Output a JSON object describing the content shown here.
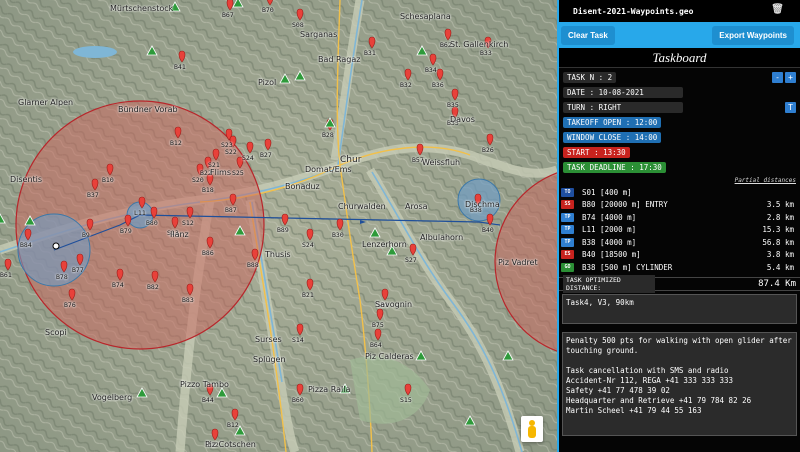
{
  "file": {
    "name": "Disent-2021-Waypoints.geo",
    "delete_icon": "trash-icon"
  },
  "buttons": {
    "clear": "Clear Task",
    "export": "Export Waypoints"
  },
  "taskboard": {
    "title": "Taskboard",
    "task_no": "TASK N : 2",
    "date": "DATE : 10-08-2021",
    "turn": "TURN : RIGHT",
    "takeoff_open": "TAKEOFF OPEN : 12:00",
    "window_close": "WINDOW CLOSE : 14:00",
    "start": "START : 13:30",
    "deadline": "TASK DEADLINE : 17:30",
    "minus": "-",
    "plus": "+",
    "t_button": "T",
    "partial_label": "Partial distances",
    "turnpoints": [
      {
        "type": "TO",
        "color": "#1f4fa0",
        "desc": "S01 [400 m]",
        "dist": ""
      },
      {
        "type": "SS",
        "color": "#c8231e",
        "desc": "B80 [20000 m] ENTRY",
        "dist": "3.5 km"
      },
      {
        "type": "TP",
        "color": "#2f7fd1",
        "desc": "B74 [4000 m]",
        "dist": "2.8 km"
      },
      {
        "type": "TP",
        "color": "#2f7fd1",
        "desc": "L11 [2000 m]",
        "dist": "15.3 km"
      },
      {
        "type": "TP",
        "color": "#2f7fd1",
        "desc": "B38 [4000 m]",
        "dist": "56.8 km"
      },
      {
        "type": "ES",
        "color": "#c8231e",
        "desc": "B40 [18500 m]",
        "dist": "3.8 km"
      },
      {
        "type": "GO",
        "color": "#2b8f35",
        "desc": "B38 [500 m] CYLINDER",
        "dist": "5.4 km"
      }
    ],
    "optimized_label": "TASK OPTIMIZED DISTANCE:",
    "optimized_value": "87.4 Km",
    "task_info": "Task4, V3, 90km",
    "notes": "Penalty 500 pts for walking with open glider after touching ground.\n\nTask cancellation with SMS and radio\nAccident-Nr 112, REGA +41 333 333 333\nSafety +41 77 478 39 02\nHeadquarter and Retrieve +41 79 784 82 26\nMartin Scheel +41 79 44 55 163"
  },
  "map": {
    "places": [
      "Mürtschenstock",
      "Glarner Alpen",
      "Schesaplana",
      "St. Gallenkirch",
      "Sarganas",
      "Bad Ragaz",
      "Pizol",
      "Bündner Vorab",
      "Chur",
      "Bonaduz",
      "Domat/Ems",
      "Weissfluh",
      "Piz Vadret",
      "Churwalden",
      "Arosa",
      "Lenzerhorn",
      "Albulahorn",
      "Ilanz",
      "Disentis",
      "Scopi",
      "Vogelberg",
      "Pizzo Tambo",
      "Piz Calderas",
      "Pizza Ralla",
      "Surses",
      "Splügen",
      "Piz Cotschen",
      "Dischma",
      "Flims",
      "Thusis",
      "Savognin",
      "Davos"
    ],
    "waypoints": [
      "B41",
      "B31",
      "B33",
      "B34",
      "B32",
      "B36",
      "B35",
      "B26",
      "B28",
      "B12",
      "S23",
      "S22",
      "S24",
      "S21",
      "S25",
      "B27",
      "S20",
      "B22",
      "B18",
      "B10",
      "L11",
      "B80",
      "S12",
      "B87",
      "B37",
      "S13",
      "B79",
      "B9",
      "B89",
      "B86",
      "B88",
      "B74",
      "B82",
      "B83",
      "B77",
      "B78",
      "B76",
      "B61",
      "B84",
      "S24",
      "B30",
      "B38",
      "B40",
      "S27",
      "B21",
      "S14",
      "B75",
      "B64",
      "S01",
      "B60",
      "B44",
      "S15",
      "B62",
      "S08",
      "B70",
      "B67",
      "B57",
      "B12",
      "Z12",
      "B35"
    ]
  },
  "colors": {
    "panel_accent": "#28a8ea",
    "start_red": "#c8231e",
    "deadline_green": "#2b8f35",
    "takeoff_blue": "#1f6fb3"
  }
}
